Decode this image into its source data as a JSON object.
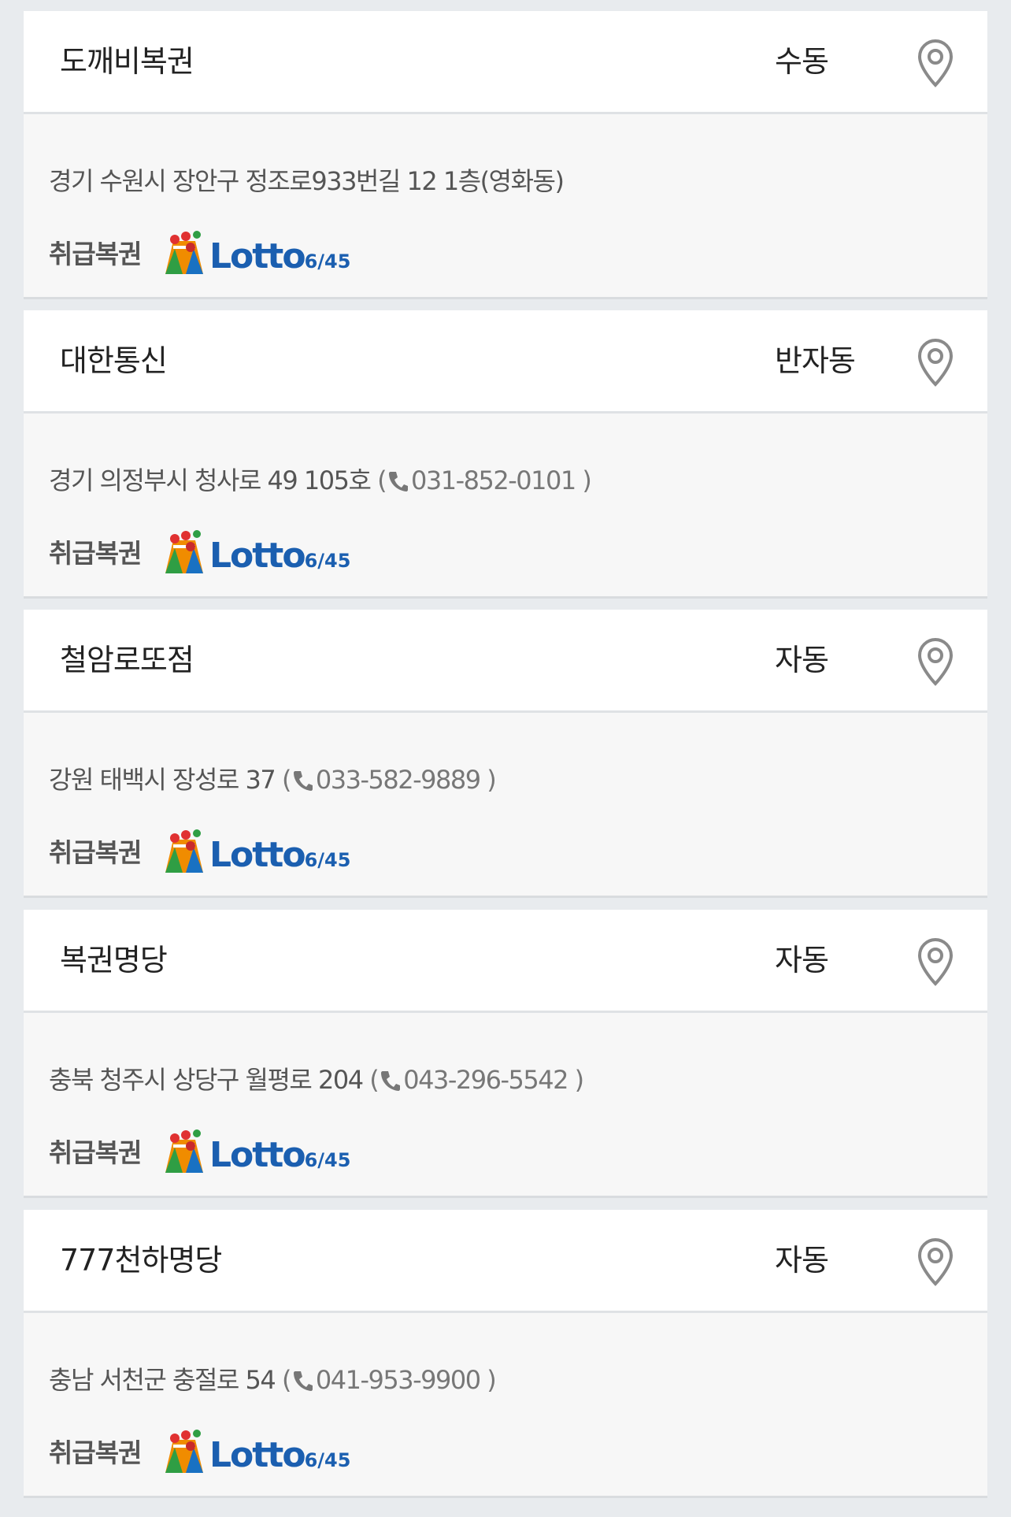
{
  "stores": [
    {
      "name": "도깨비복권",
      "method": "수동",
      "address": "경기 수원시 장안구 정조로933번길 12 1층(영화동)",
      "phone": "",
      "tickets_label": "취급복권",
      "lottery_brand": "Lotto",
      "lottery_type": "6/45"
    },
    {
      "name": "대한통신",
      "method": "반자동",
      "address": "경기 의정부시 청사로 49 105호",
      "phone": "031-852-0101",
      "tickets_label": "취급복권",
      "lottery_brand": "Lotto",
      "lottery_type": "6/45"
    },
    {
      "name": "철암로또점",
      "method": "자동",
      "address": "강원 태백시 장성로 37",
      "phone": "033-582-9889",
      "tickets_label": "취급복권",
      "lottery_brand": "Lotto",
      "lottery_type": "6/45"
    },
    {
      "name": "복권명당",
      "method": "자동",
      "address": "충북 청주시 상당구 월평로 204",
      "phone": "043-296-5542",
      "tickets_label": "취급복권",
      "lottery_brand": "Lotto",
      "lottery_type": "6/45"
    },
    {
      "name": "777천하명당",
      "method": "자동",
      "address": "충남 서천군 충절로 54",
      "phone": "041-953-9900",
      "tickets_label": "취급복권",
      "lottery_brand": "Lotto",
      "lottery_type": "6/45"
    }
  ],
  "icons": {
    "map": "map-pin-icon",
    "phone": "phone-icon",
    "lottery": "lotto-logo"
  },
  "colors": {
    "page_bg": "#e8ebee",
    "card_body_bg": "#f7f7f7",
    "header_bg": "#ffffff",
    "lotto_blue": "#1b5fb0"
  }
}
